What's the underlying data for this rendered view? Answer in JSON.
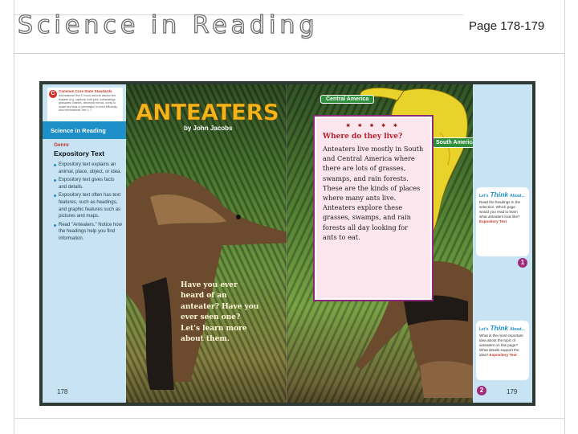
{
  "slide": {
    "title": "Science in Reading",
    "page_ref": "Page 178-179"
  },
  "left_page": {
    "standards_title": "Common Core State Standards",
    "standards_text": "Informational Text 5. Know and use various text features (e.g. captions, bold print, subheadings, glossaries, indexes, electronic menus, icons) to locate key facts or information in a text efficiently. Also Informational Text 1, 7.",
    "banner": "Science in Reading",
    "genre_label": "Genre",
    "genre_name": "Expository Text",
    "genre_points": [
      "Expository text explains an animal, place, object, or idea.",
      "Expository text gives facts and details.",
      "Expository text often has text features, such as headings, and graphic features such as pictures and maps.",
      "Read \"Anteaters.\" Notice how the headings help you find information."
    ],
    "page_number": "178",
    "headline": "ANTEATERS",
    "byline": "by John Jacobs",
    "intro": "Have you ever heard of an anteater? Have you ever seen one? Let's learn more about them."
  },
  "right_page": {
    "map_label_central": "Central America",
    "map_label_south": "South America",
    "question_title": "Where do they live?",
    "question_body": "Anteaters live mostly in South and Central America where there are lots of grasses, swamps, and rain forests. These are the kinds of places where many ants live. Anteaters explore these grasses, swamps, and rain forests all day looking for ants to eat.",
    "think1_pre": "Let's",
    "think1_word": "Think",
    "think1_post": "About...",
    "think1_text": "Read the headings in the selection. Which page would you read to learn what anteaters look like?",
    "think1_tag": "Expository Text",
    "think2_pre": "Let's",
    "think2_word": "Think",
    "think2_post": "About...",
    "think2_text": "What is the most important idea about the topic of anteaters on this page? What details support the idea?",
    "think2_tag": "Expository Text",
    "marker1": "1",
    "marker2": "2",
    "page_number": "179"
  },
  "colors": {
    "headline": "#f2b61a",
    "sidebar": "#c8e4f4",
    "banner": "#1d8fc9",
    "question_border": "#8c2a7a",
    "map_land": "#e9d22a"
  },
  "icons": [
    "common-core-icon",
    "ant-icon",
    "anteater-photo",
    "south-america-map"
  ]
}
